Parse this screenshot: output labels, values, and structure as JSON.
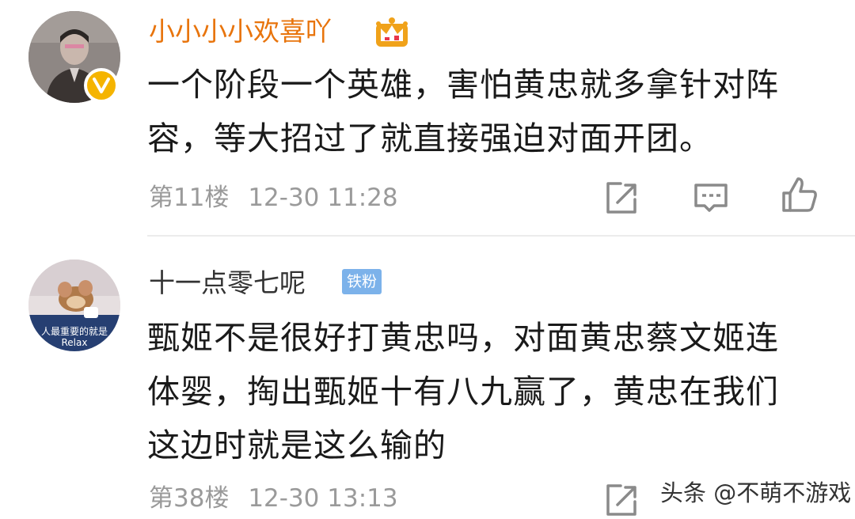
{
  "comments": [
    {
      "username": "小小小小欢喜吖",
      "content_lines": [
        "一个阶段一个英雄，害怕黄忠就多拿针对阵",
        "容，等大招过了就直接强迫对面开团。"
      ],
      "floor": "第11楼",
      "time": "12-30 11:28",
      "username_color": "#e8740c",
      "avatar_icon": "person-avatar",
      "verified_icon": "verified-v-badge",
      "level_icon": "crown-badge"
    },
    {
      "username": "十一点零七呢",
      "badge": "铁粉",
      "avatar_text": "人最重要的就是",
      "avatar_text2": "Relax",
      "content_lines": [
        "甄姬不是很好打黄忠吗，对面黄忠蔡文姬连",
        "体婴，掏出甄姬十有八九赢了，黄忠在我们",
        "这边时就是这么输的"
      ],
      "floor": "第38楼",
      "time": "12-30 13:13",
      "avatar_icon": "cartoon-mouse-avatar"
    }
  ],
  "watermark": "头条 @不萌不游戏",
  "colors": {
    "fan_badge": "#7cb2ea",
    "verified": "#f5b400",
    "meta_text": "#9a9a9a"
  }
}
